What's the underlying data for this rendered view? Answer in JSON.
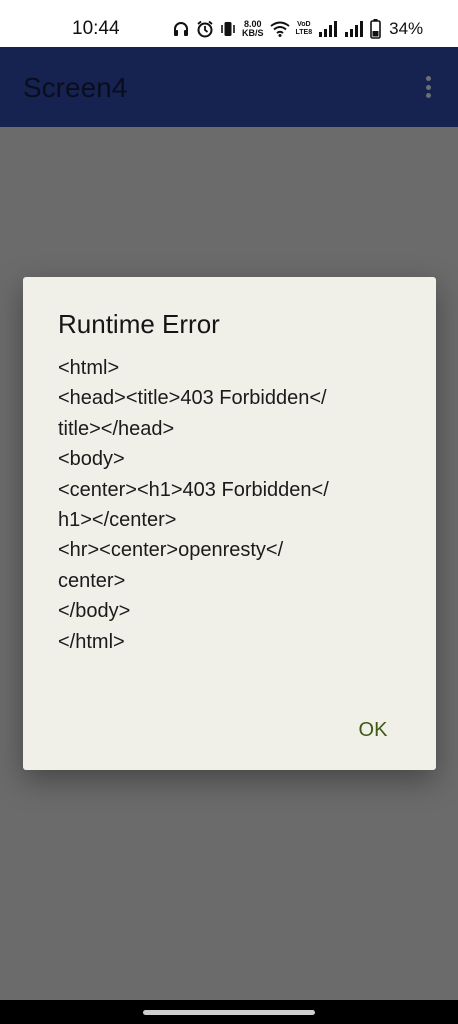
{
  "status_bar": {
    "time": "10:44",
    "net_speed_value": "8.00",
    "net_speed_unit": "KB/S",
    "volte_top": "VoD",
    "volte_bottom": "LTE8",
    "battery": "34%",
    "icons": [
      "headphones-icon",
      "alarm-icon",
      "vibrate-icon",
      "wifi-icon",
      "signal-icon",
      "signal-icon",
      "battery-icon"
    ]
  },
  "app_bar": {
    "title": "Screen4",
    "overflow_icon": "more-vert-icon"
  },
  "dialog": {
    "title": "Runtime Error",
    "message_lines": [
      "<html>",
      "<head><title>403 Forbidden</",
      "title></head>",
      "<body>",
      "<center><h1>403 Forbidden</",
      "h1></center>",
      "<hr><center>openresty</",
      "center>",
      "</body>",
      "</html>"
    ],
    "ok_label": "OK"
  },
  "colors": {
    "app_bar": "#162250",
    "scrim": "#6b6b6b",
    "dialog_bg": "#f0efe8",
    "accent": "#3d5a16"
  }
}
